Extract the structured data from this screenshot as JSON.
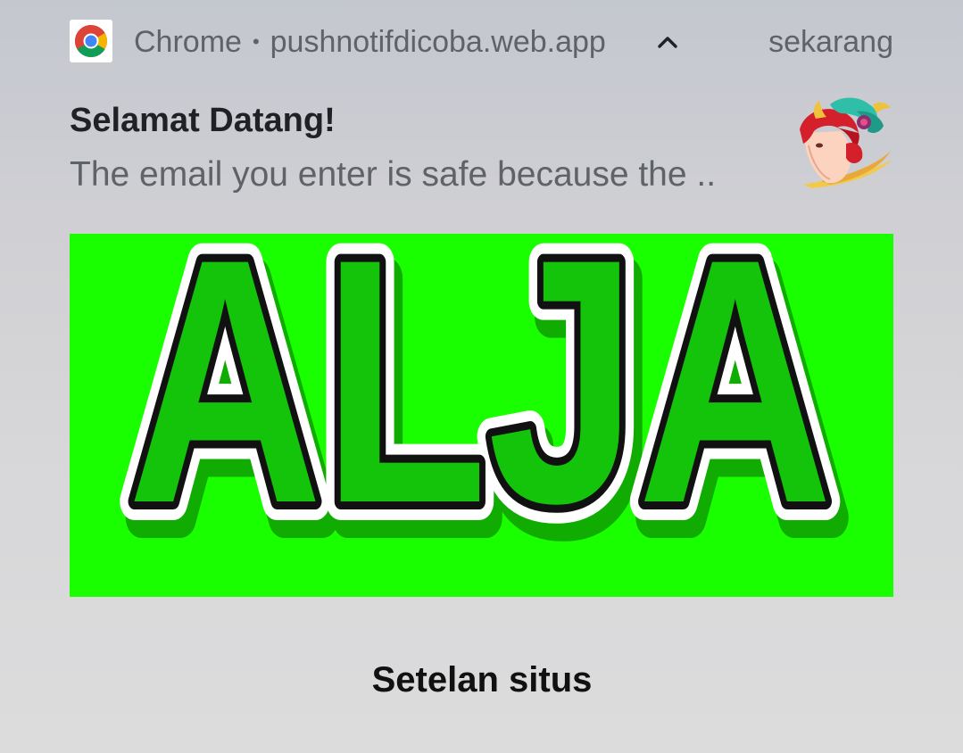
{
  "notification": {
    "app_name": "Chrome",
    "separator": "•",
    "origin": "pushnotifdicoba.web.app",
    "timestamp": "sekarang",
    "title": "Selamat Datang!",
    "body": "The email you enter is safe because the ..",
    "app_icon": "chrome-icon",
    "expand_icon": "chevron-up-icon",
    "avatar_icon": "game-character-avatar",
    "big_picture": {
      "text": "ALJA",
      "background_color": "#1aff00",
      "letter_color": "#14c40a"
    }
  },
  "actions": {
    "site_settings_label": "Setelan situs"
  }
}
